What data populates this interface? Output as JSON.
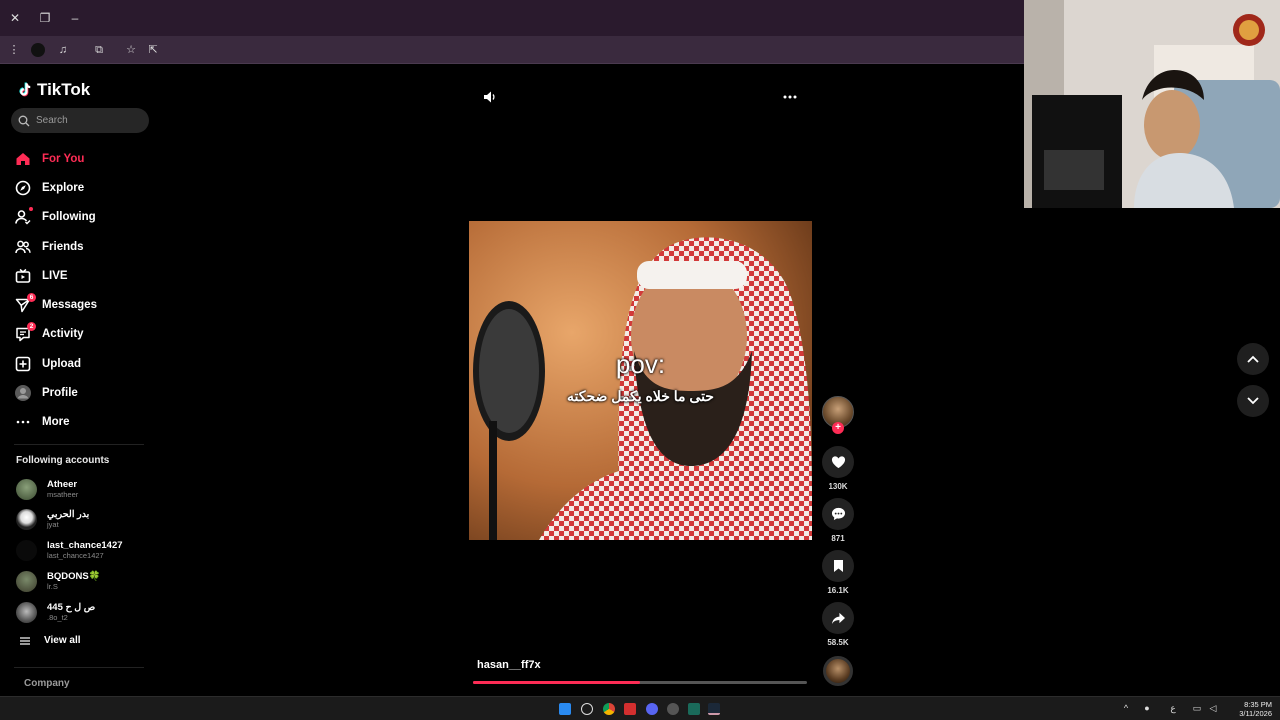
{
  "app": {
    "name": "TikTok"
  },
  "search": {
    "placeholder": "Search"
  },
  "nav": [
    {
      "label": "For You",
      "icon": "home-icon",
      "active": true
    },
    {
      "label": "Explore",
      "icon": "compass-icon"
    },
    {
      "label": "Following",
      "icon": "following-icon"
    },
    {
      "label": "Friends",
      "icon": "friends-icon"
    },
    {
      "label": "LIVE",
      "icon": "live-icon"
    },
    {
      "label": "Messages",
      "icon": "messages-icon",
      "badge": "6"
    },
    {
      "label": "Activity",
      "icon": "activity-icon",
      "badge": "2"
    },
    {
      "label": "Upload",
      "icon": "upload-icon"
    },
    {
      "label": "Profile",
      "icon": "profile-avatar"
    },
    {
      "label": "More",
      "icon": "more-icon"
    }
  ],
  "following": {
    "title": "Following accounts",
    "accounts": [
      {
        "name": "Atheer",
        "handle": "msatheer"
      },
      {
        "name": "بدر الحربي",
        "handle": "jyat"
      },
      {
        "name": "last_chance1427",
        "handle": "last_chance1427"
      },
      {
        "name": "BQDONS🍀",
        "handle": "lr.S"
      },
      {
        "name": "ص ل ح 445",
        "handle": ".8o_t2"
      }
    ],
    "view_all": "View all"
  },
  "footer": {
    "company": "Company"
  },
  "video": {
    "caption_line1": "pov:",
    "caption_line2": "حتى ما خلاه يكمل ضحكته",
    "username": "hasan__ff7x",
    "progress": 0.5
  },
  "actions": {
    "likes": "130K",
    "comments": "871",
    "saves": "16.1K",
    "shares": "58.5K"
  },
  "taskbar": {
    "time": "8:35 PM",
    "date": "3/11/2026",
    "lang": "ع"
  },
  "colors": {
    "accent": "#fe2c55",
    "background": "#000000",
    "chrome": "#2a1a2d"
  }
}
